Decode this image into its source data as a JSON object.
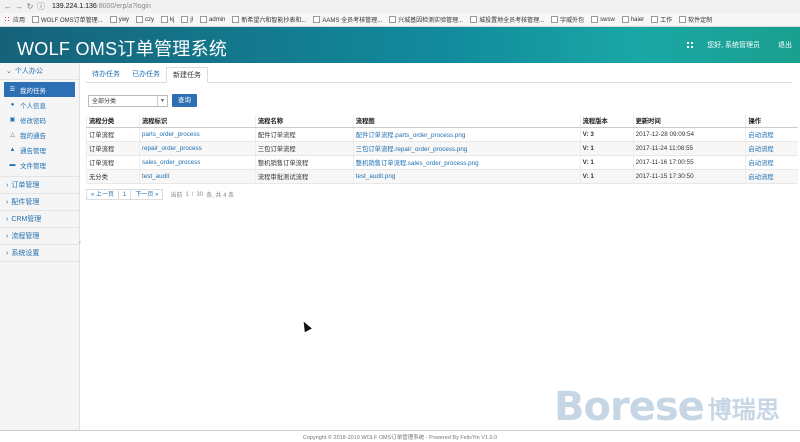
{
  "browser": {
    "url_host": "139.224.1.136",
    "url_path": ":8000/erp/a?login",
    "bookmarks": [
      "应用",
      "WOLF OMS订单管理...",
      "ywy",
      "czy",
      "kj",
      "jl",
      "admin",
      "新希望六和智能抄表和...",
      "AAMS 全员考核管理...",
      "兴城基因检测实验管理...",
      "城投置地全员考核管理...",
      "宇威外包",
      "swsw",
      "haier",
      "工作",
      "软件定制"
    ]
  },
  "header": {
    "title": "WOLF OMS订单管理系统",
    "greeting": "您好, 系统管理员",
    "logout": "退出",
    "accent": "#128a9c"
  },
  "sidebar": {
    "personal": {
      "label": "个人办公",
      "items": [
        {
          "label": "我的任务",
          "icon": "list-icon"
        },
        {
          "label": "个人信息",
          "icon": "user-icon"
        },
        {
          "label": "修改密码",
          "icon": "lock-icon"
        },
        {
          "label": "我的通告",
          "icon": "bell-icon"
        },
        {
          "label": "通告管理",
          "icon": "bell-icon"
        },
        {
          "label": "文件管理",
          "icon": "folder-icon"
        }
      ]
    },
    "groups": [
      "订单管理",
      "配件管理",
      "CRM管理",
      "流程管理",
      "系统设置"
    ]
  },
  "tabs": [
    "待办任务",
    "已办任务",
    "新建任务"
  ],
  "filter": {
    "select_value": "全部分类",
    "query_label": "查询"
  },
  "table": {
    "headers": [
      "流程分类",
      "流程标识",
      "流程名称",
      "流程图",
      "流程版本",
      "更新时间",
      "操作"
    ],
    "rows": [
      [
        "订单流程",
        "parts_order_process",
        "配件订单流程",
        "配件订单流程.parts_order_process.png",
        "V: 3",
        "2017-12-28 09:09:54",
        "启动流程"
      ],
      [
        "订单流程",
        "repair_order_process",
        "三包订单流程",
        "三包订单流程.repair_order_process.png",
        "V: 1",
        "2017-11-24 11:08:55",
        "启动流程"
      ],
      [
        "订单流程",
        "sales_order_process",
        "整机销售订单流程",
        "整机销售订单流程.sales_order_process.png",
        "V: 1",
        "2017-11-16 17:00:55",
        "启动流程"
      ],
      [
        "无分类",
        "test_audit",
        "流程审批测试流程",
        "test_audit.png",
        "V: 1",
        "2017-11-15 17:30:50",
        "启动流程"
      ]
    ]
  },
  "pager": {
    "prev": "« 上一页",
    "page": "1",
    "next": "下一页 »",
    "current_label": "当前",
    "current_value": "1",
    "sep": "/",
    "per_page": "30",
    "total_text": "条, 共 4 条"
  },
  "footer": "Copyright © 2018-2019 WOLF OMS订单管理系统 - Powered By FelixYin V1.0.0",
  "watermark": {
    "latin": "Borese",
    "cn": "博瑞思"
  }
}
